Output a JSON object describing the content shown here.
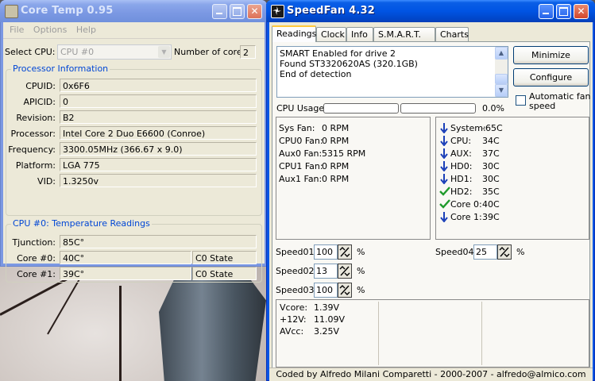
{
  "coretemp": {
    "title": "Core Temp 0.95",
    "menu": [
      "File",
      "Options",
      "Help"
    ],
    "select_cpu_label": "Select CPU:",
    "select_cpu_value": "CPU #0",
    "cores_label": "Number of cores",
    "cores_value": "2",
    "proc_group_title": "Processor Information",
    "proc": [
      {
        "label": "CPUID:",
        "value": "0x6F6"
      },
      {
        "label": "APICID:",
        "value": "0"
      },
      {
        "label": "Revision:",
        "value": "B2"
      },
      {
        "label": "Processor:",
        "value": "Intel Core 2 Duo E6600 (Conroe)"
      },
      {
        "label": "Frequency:",
        "value": "3300.05MHz (366.67 x 9.0)"
      },
      {
        "label": "Platform:",
        "value": "LGA 775"
      },
      {
        "label": "VID:",
        "value": "1.3250v"
      }
    ],
    "temp_group_title": "CPU #0: Temperature Readings",
    "tjunction_label": "Tjunction:",
    "tjunction_value": "85C°",
    "cores": [
      {
        "label": "Core #0:",
        "value": "40C°",
        "state": "C0 State"
      },
      {
        "label": "Core #1:",
        "value": "39C°",
        "state": "C0 State"
      }
    ]
  },
  "speedfan": {
    "title": "SpeedFan 4.32",
    "tabs": [
      "Readings",
      "Clock",
      "Info",
      "S.M.A.R.T.",
      "Charts"
    ],
    "log_lines": [
      "SMART Enabled for drive 2",
      "Found ST3320620AS (320.1GB)",
      "End of detection"
    ],
    "minimize_label": "Minimize",
    "configure_label": "Configure",
    "auto_fan_label": "Automatic fan speed",
    "cpu_usage_label": "CPU Usage",
    "cpu_usage_value": "0.0%",
    "cpu_usage_fraction": 0.0,
    "fans": [
      {
        "label": "Sys Fan:",
        "value": "0 RPM"
      },
      {
        "label": "CPU0 Fan:",
        "value": "0 RPM"
      },
      {
        "label": "Aux0 Fan:",
        "value": "5315 RPM"
      },
      {
        "label": "CPU1 Fan:",
        "value": "0 RPM"
      },
      {
        "label": "Aux1 Fan:",
        "value": "0 RPM"
      }
    ],
    "temps": [
      {
        "label": "System:",
        "value": "-65C",
        "icon": "down-arrow-icon"
      },
      {
        "label": "CPU:",
        "value": "34C",
        "icon": "down-arrow-icon"
      },
      {
        "label": "AUX:",
        "value": "37C",
        "icon": "down-arrow-icon"
      },
      {
        "label": "HD0:",
        "value": "30C",
        "icon": "down-arrow-icon"
      },
      {
        "label": "HD1:",
        "value": "30C",
        "icon": "down-arrow-icon"
      },
      {
        "label": "HD2:",
        "value": "35C",
        "icon": "check-icon"
      },
      {
        "label": "Core 0:",
        "value": "40C",
        "icon": "check-icon"
      },
      {
        "label": "Core 1:",
        "value": "39C",
        "icon": "down-arrow-icon"
      }
    ],
    "speeds": [
      {
        "label": "Speed01:",
        "value": "100",
        "unit": "%"
      },
      {
        "label": "Speed02:",
        "value": "13",
        "unit": "%"
      },
      {
        "label": "Speed03:",
        "value": "100",
        "unit": "%"
      },
      {
        "label": "Speed04:",
        "value": "25",
        "unit": "%"
      }
    ],
    "voltages": [
      {
        "label": "Vcore:",
        "value": "1.39V"
      },
      {
        "label": "+12V:",
        "value": "11.09V"
      },
      {
        "label": "AVcc:",
        "value": "3.25V"
      }
    ],
    "footer": "Coded by Alfredo Milani Comparetti - 2000-2007 - alfredo@almico.com"
  },
  "colors": {
    "xp_blue": "#0054e3",
    "group_title": "#0046d5",
    "arrow_blue": "#1a3fb8",
    "check_green": "#1f9a2b"
  }
}
